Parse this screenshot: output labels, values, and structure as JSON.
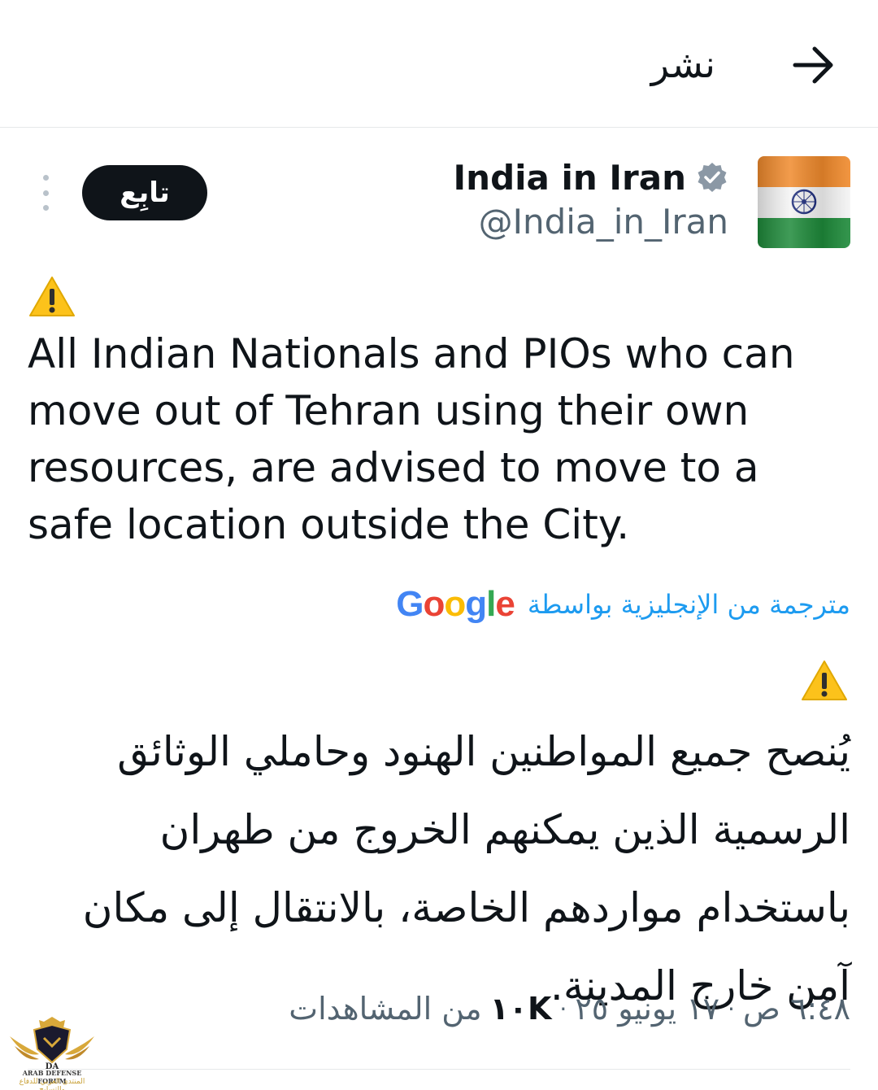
{
  "header": {
    "title": "نشر",
    "back_icon": "arrow-right-icon"
  },
  "author": {
    "name": "India in Iran",
    "handle": "@India_in_Iran",
    "verified": true,
    "avatar": "india-flag",
    "follow_label": "تابِع"
  },
  "tweet": {
    "warning_icon": "warning-icon",
    "text_en": "All Indian Nationals and PIOs who can move out of Tehran using their own resources, are advised to move to a safe location outside the City.",
    "translation_label": "مترجمة من الإنجليزية بواسطة",
    "translation_provider": "Google",
    "text_ar": "يُنصح جميع المواطنين الهنود وحاملي الوثائق الرسمية الذين يمكنهم الخروج من طهران باستخدام مواردهم الخاصة، بالانتقال إلى مكان آمن خارج المدينة."
  },
  "meta": {
    "time": "٦:٤٨ ص",
    "date": "١٧ يونيو ٢٥",
    "views_count": "١٠K",
    "views_label": "من المشاهدات",
    "separator": "·"
  },
  "watermark": {
    "title": "ARAB DEFENSE FORUM",
    "subtitle": "المنتدى العربي للدفاع والتسليح",
    "initials": "DA"
  }
}
